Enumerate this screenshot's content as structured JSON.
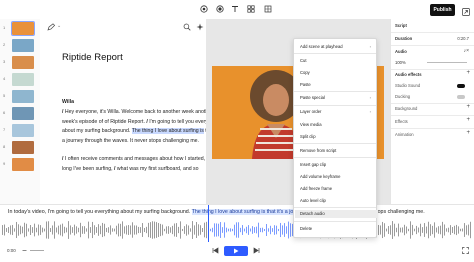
{
  "topbar": {
    "tools": [
      "record-icon",
      "record-dot-icon",
      "text-icon",
      "shapes-icon"
    ],
    "publish_label": "Publish"
  },
  "thumbnails": [
    {
      "number": "1",
      "color": "#e9913a"
    },
    {
      "number": "2",
      "color": "#7aa7c7"
    },
    {
      "number": "3",
      "color": "#d98e4b"
    },
    {
      "number": "4",
      "color": "#c5d9d1"
    },
    {
      "number": "5",
      "color": "#8fb6cf"
    },
    {
      "number": "6",
      "color": "#6f96b5"
    },
    {
      "number": "7",
      "color": "#a8c6dc"
    },
    {
      "number": "8",
      "color": "#b06b3e"
    },
    {
      "number": "9",
      "color": "#e18c45"
    }
  ],
  "document": {
    "title": "Riptide Report",
    "speaker": "Willa",
    "para1_a": "Hey everyone, it's Willa. Welcome back to another week another week's episode of of Riptide Report.",
    "para1_b": "I'm going to tell you everything about my surfing background.",
    "para1_hl": "The thing I love about surfing is",
    "para1_c": "that it's a journey through the waves. It never stops challenging me.",
    "para2_a": "I often receive comments and messages about how I started, how long I've been surfing,",
    "para2_b": "what was my first surfboard, and so"
  },
  "context_menu": {
    "items": [
      {
        "label": "Add scene at playhead",
        "arrow": true
      },
      {
        "label": "Cut"
      },
      {
        "label": "Copy"
      },
      {
        "label": "Paste"
      },
      {
        "label": "Paste special",
        "arrow": true
      },
      {
        "label": "Layer order",
        "arrow": true
      },
      {
        "label": "View media"
      },
      {
        "label": "Split clip"
      },
      {
        "label": "Remove from script"
      },
      {
        "label": "Insert gap clip"
      },
      {
        "label": "Add volume keyframe"
      },
      {
        "label": "Add freeze frame"
      },
      {
        "label": "Auto level clip"
      },
      {
        "label": "Detach audio"
      },
      {
        "label": "Delete"
      }
    ],
    "arrow_glyph": "›"
  },
  "properties": {
    "script_label": "Script",
    "duration_label": "Duration",
    "duration_value": "0:20.7",
    "audio_label": "Audio",
    "volume_value": "100%",
    "audio_effects_label": "Audio effects",
    "studio_sound_label": "Studio Sound",
    "studio_sound_on": true,
    "ducking_label": "Ducking",
    "ducking_on": false,
    "background_label": "Background",
    "effects_label": "Effects",
    "animation_label": "Animation"
  },
  "timeline": {
    "text_left": "In today's video, I'm going to tell you everything about my surfing background.",
    "text_mid": "The thing I love about surfing is that it's a journey through the waves.",
    "text_right": "It never stops challenging me.",
    "time": "0:00",
    "accent": "#2e5bff"
  }
}
